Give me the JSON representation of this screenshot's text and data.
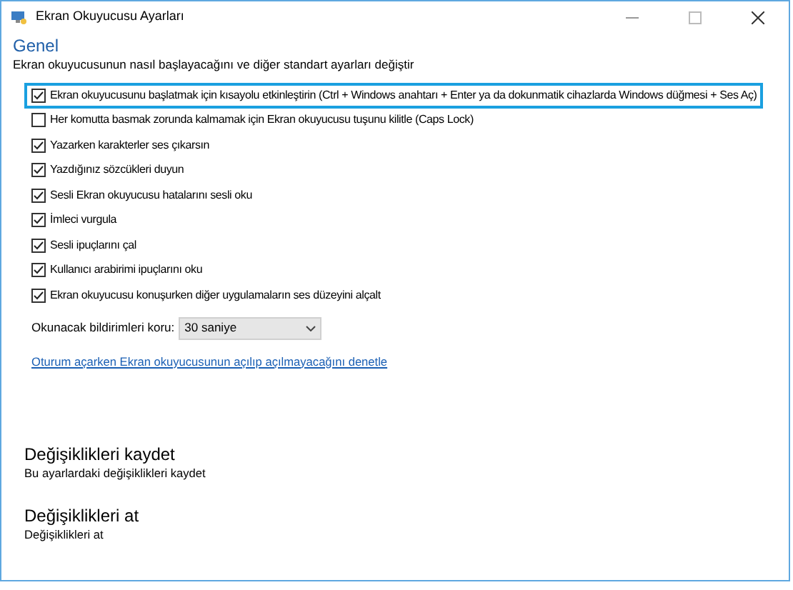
{
  "window": {
    "title": "Ekran Okuyucusu Ayarları"
  },
  "section": {
    "title": "Genel",
    "subtitle": "Ekran okuyucusunun nasıl başlayacağını ve diğer standart ayarları değiştir"
  },
  "options": [
    {
      "label": "Ekran okuyucusunu başlatmak için kısayolu etkinleştirin (Ctrl + Windows anahtarı + Enter ya da dokunmatik cihazlarda Windows düğmesi + Ses Aç)",
      "checked": true,
      "focused": true
    },
    {
      "label": "Her komutta basmak zorunda kalmamak için Ekran okuyucusu tuşunu kilitle (Caps Lock)",
      "checked": false,
      "focused": false
    },
    {
      "label": "Yazarken karakterler ses çıkarsın",
      "checked": true,
      "focused": false
    },
    {
      "label": "Yazdığınız sözcükleri duyun",
      "checked": true,
      "focused": false
    },
    {
      "label": "Sesli Ekran okuyucusu hatalarını sesli oku",
      "checked": true,
      "focused": false
    },
    {
      "label": "İmleci vurgula",
      "checked": true,
      "focused": false
    },
    {
      "label": "Sesli ipuçlarını çal",
      "checked": true,
      "focused": false
    },
    {
      "label": "Kullanıcı arabirimi ipuçlarını oku",
      "checked": true,
      "focused": false
    },
    {
      "label": "Ekran okuyucusu konuşurken diğer uygulamaların ses düzeyini alçalt",
      "checked": true,
      "focused": false
    }
  ],
  "notification": {
    "label": "Okunacak bildirimleri koru:",
    "value": "30 saniye"
  },
  "link": "Oturum açarken Ekran okuyucusunun açılıp açılmayacağını denetle",
  "actions": [
    {
      "title": "Değişiklikleri kaydet",
      "description": "Bu ayarlardaki değişiklikleri kaydet"
    },
    {
      "title": "Değişiklikleri at",
      "description": "Değişiklikleri at"
    }
  ]
}
